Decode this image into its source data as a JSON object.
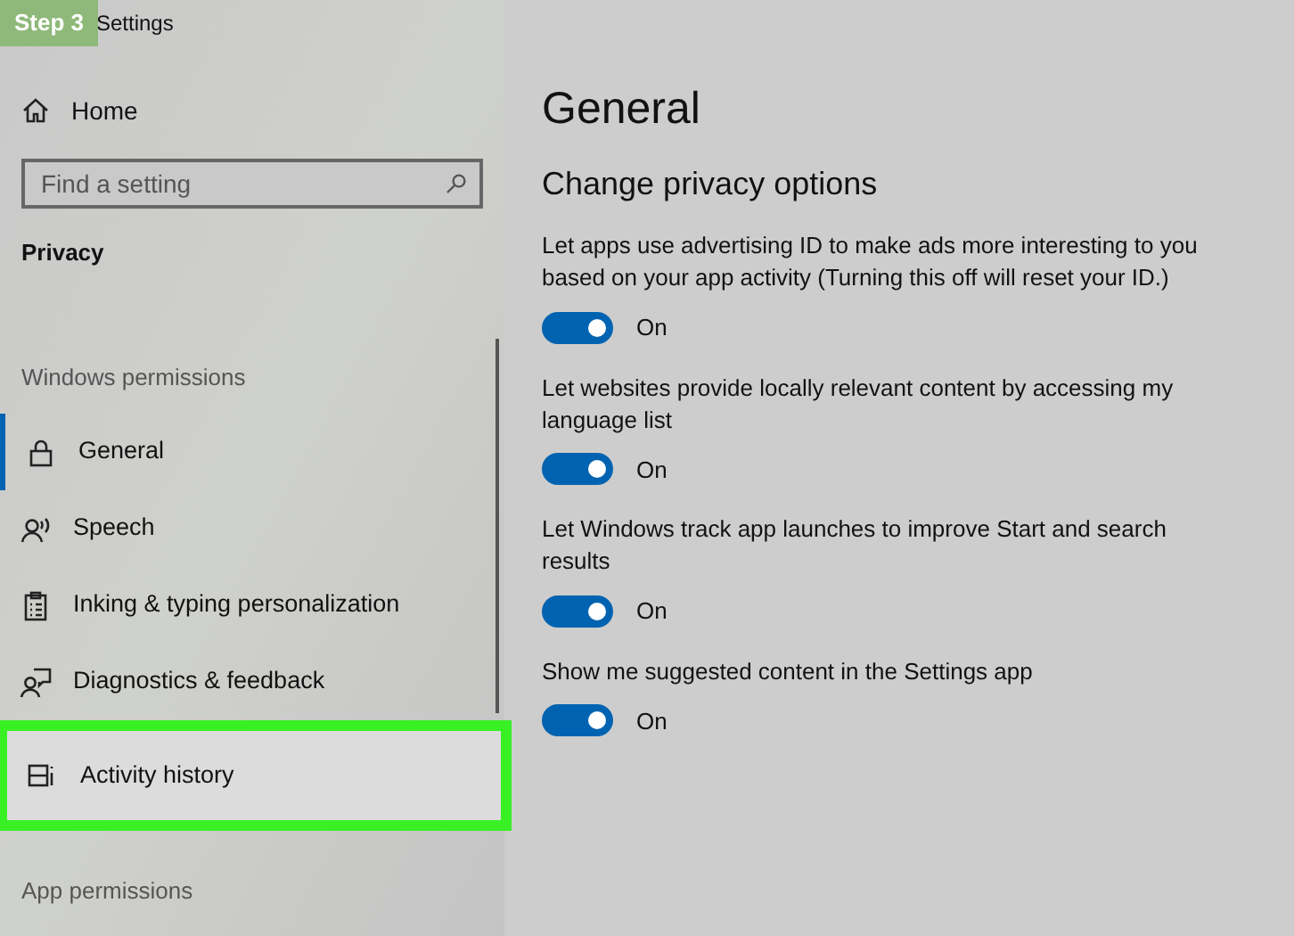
{
  "step_badge": "Step 3",
  "window": {
    "title": "Settings"
  },
  "sidebar": {
    "home": "Home",
    "search": {
      "placeholder": "Find a setting"
    },
    "section": "Privacy",
    "groups": [
      {
        "heading": "Windows permissions",
        "items": [
          {
            "kind": "lock",
            "label": "General",
            "selected": true,
            "highlighted": false
          },
          {
            "kind": "speech",
            "label": "Speech",
            "selected": false,
            "highlighted": false
          },
          {
            "kind": "clipboard",
            "label": "Inking & typing personalization",
            "selected": false,
            "highlighted": false
          },
          {
            "kind": "feedback",
            "label": "Diagnostics & feedback",
            "selected": false,
            "highlighted": false
          },
          {
            "kind": "timeline",
            "label": "Activity history",
            "selected": false,
            "highlighted": true
          }
        ]
      },
      {
        "heading": "App permissions"
      }
    ]
  },
  "main": {
    "title": "General",
    "subtitle": "Change privacy options",
    "options": [
      {
        "text": "Let apps use advertising ID to make ads more interesting to you based on your app activity (Turning this off will reset your ID.)",
        "on": true,
        "state": "On"
      },
      {
        "text": "Let websites provide locally relevant content by accessing my language list",
        "on": true,
        "state": "On"
      },
      {
        "text": "Let Windows track app launches to improve Start and search results",
        "on": true,
        "state": "On"
      },
      {
        "text": "Show me suggested content in the Settings app",
        "on": true,
        "state": "On"
      }
    ]
  }
}
